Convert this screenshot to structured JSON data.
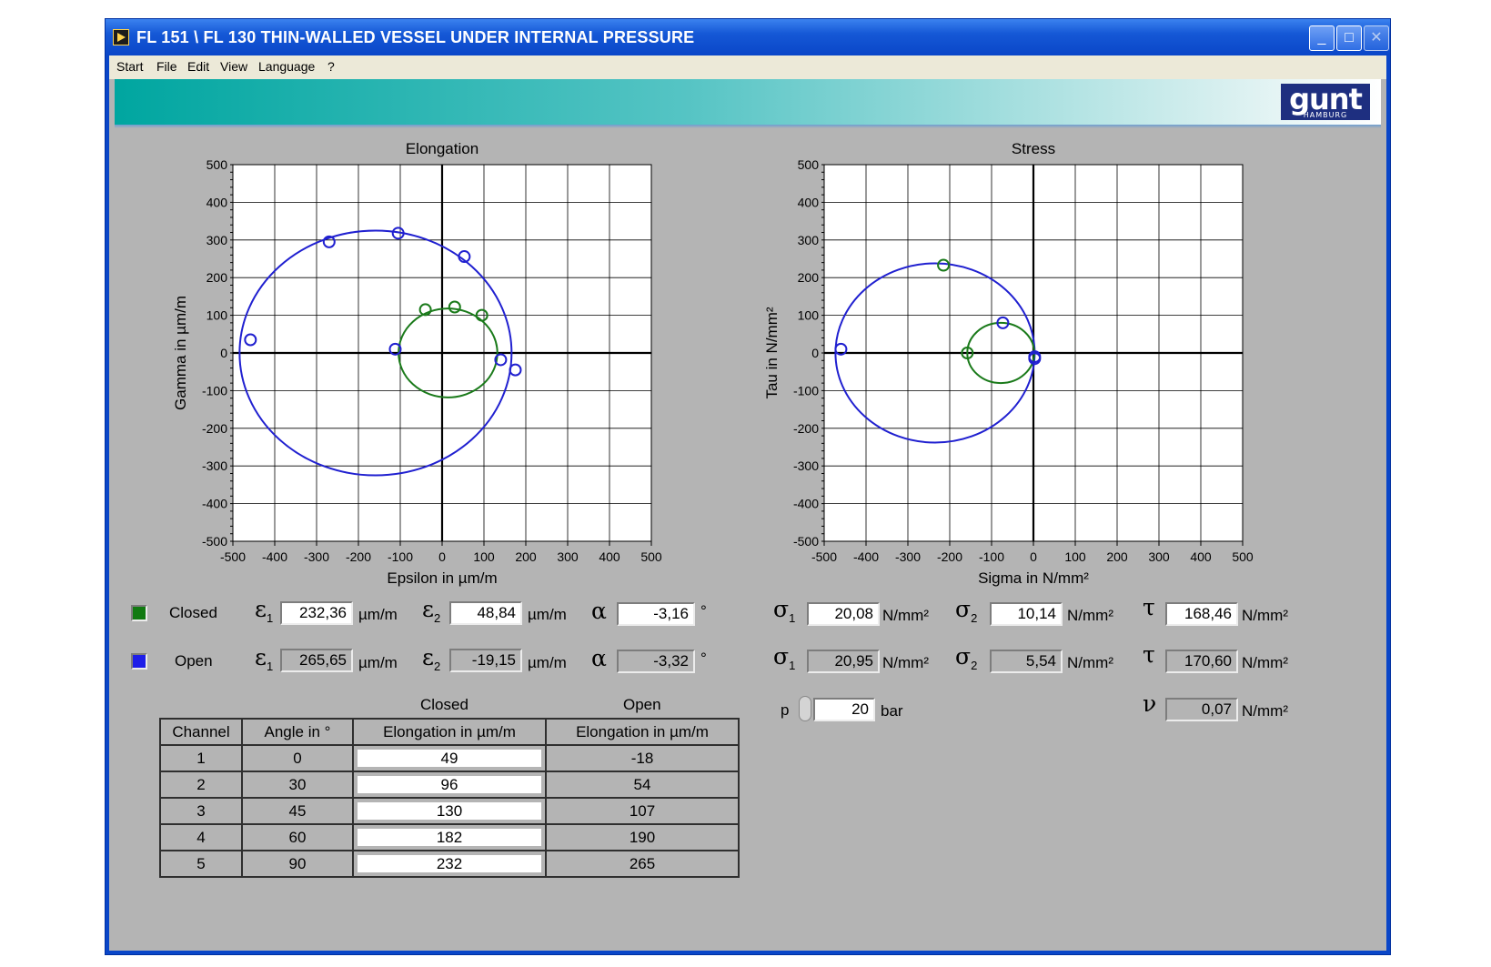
{
  "window": {
    "title": "FL 151 \\ FL 130 THIN-WALLED VESSEL UNDER INTERNAL PRESSURE",
    "min_symbol": "_",
    "max_symbol": "□",
    "close_symbol": "✕"
  },
  "menu": {
    "items": [
      "Start",
      "File",
      "Edit",
      "View",
      "Language",
      "?"
    ]
  },
  "logo": {
    "text": "gunt",
    "subtext": "HAMBURG"
  },
  "chart_data": [
    {
      "type": "scatter",
      "title": "Elongation",
      "xlabel": "Epsilon in µm/m",
      "ylabel": "Gamma in µm/m",
      "xlim": [
        -500,
        500
      ],
      "ylim": [
        -500,
        500
      ],
      "xticks": [
        "-500",
        "-400",
        "-300",
        "-200",
        "-100",
        "0",
        "100",
        "200",
        "300",
        "400",
        "500"
      ],
      "yticks": [
        "500",
        "400",
        "300",
        "200",
        "100",
        "0",
        "-100",
        "-200",
        "-300",
        "-400",
        "-500"
      ],
      "grid": true,
      "circles": [
        {
          "center": [
            -159,
            0
          ],
          "radius": 325,
          "color": "#2020d0"
        },
        {
          "center": [
            14,
            0
          ],
          "radius": 118,
          "color": "#1a7a1a"
        }
      ],
      "series": [
        {
          "color": "#2020d0",
          "points": [
            [
              -458,
              35
            ],
            [
              -270,
              295
            ],
            [
              -105,
              318
            ],
            [
              53,
              256
            ],
            [
              140,
              -18
            ],
            [
              175,
              -45
            ],
            [
              -112,
              10
            ]
          ]
        },
        {
          "color": "#1a7a1a",
          "points": [
            [
              -40,
              115
            ],
            [
              30,
              122
            ],
            [
              95,
              100
            ]
          ]
        }
      ]
    },
    {
      "type": "scatter",
      "title": "Stress",
      "xlabel": "Sigma in N/mm²",
      "ylabel": "Tau in N/mm²",
      "xlim": [
        -500,
        500
      ],
      "ylim": [
        -500,
        500
      ],
      "xticks": [
        "-500",
        "-400",
        "-300",
        "-200",
        "-100",
        "0",
        "100",
        "200",
        "300",
        "400",
        "500"
      ],
      "yticks": [
        "500",
        "400",
        "300",
        "200",
        "100",
        "0",
        "-100",
        "-200",
        "-300",
        "-400",
        "-500"
      ],
      "grid": true,
      "circles": [
        {
          "center": [
            -235,
            0
          ],
          "radius": 238,
          "color": "#2020d0"
        },
        {
          "center": [
            -78,
            0
          ],
          "radius": 80,
          "color": "#1a7a1a"
        }
      ],
      "series": [
        {
          "color": "#1a7a1a",
          "points": [
            [
              -215,
              233
            ],
            [
              -158,
              0
            ]
          ]
        },
        {
          "color": "#2020d0",
          "points": [
            [
              -460,
              10
            ],
            [
              -73,
              80
            ],
            [
              3,
              -10
            ],
            [
              3,
              -15
            ]
          ]
        }
      ]
    }
  ],
  "legend": {
    "closed": {
      "label": "Closed",
      "color": "#117a11"
    },
    "open": {
      "label": "Open",
      "color": "#1e1ee8"
    }
  },
  "elongation": {
    "eps1_symbol": "ε",
    "eps2_symbol": "ε",
    "alpha_symbol": "α",
    "sub1": "1",
    "sub2": "2",
    "unit": "µm/m",
    "degree": "°",
    "closed": {
      "eps1": "232,36",
      "eps2": "48,84",
      "alpha": "-3,16"
    },
    "open": {
      "eps1": "265,65",
      "eps2": "-19,15",
      "alpha": "-3,32"
    }
  },
  "stress": {
    "sigma_symbol": "σ",
    "tau_symbol": "τ",
    "nu_symbol": "ν",
    "unit": "N/mm²",
    "closed": {
      "sigma1": "20,08",
      "sigma2": "10,14",
      "tau": "168,46"
    },
    "open": {
      "sigma1": "20,95",
      "sigma2": "5,54",
      "tau": "170,60"
    },
    "nu": "0,07"
  },
  "pressure": {
    "label": "p",
    "value": "20",
    "unit": "bar"
  },
  "table": {
    "group_closed": "Closed",
    "group_open": "Open",
    "headers": [
      "Channel",
      "Angle in °",
      "Elongation in µm/m",
      "Elongation in µm/m"
    ],
    "rows": [
      [
        "1",
        "0",
        "49",
        "-18"
      ],
      [
        "2",
        "30",
        "96",
        "54"
      ],
      [
        "3",
        "45",
        "130",
        "107"
      ],
      [
        "4",
        "60",
        "182",
        "190"
      ],
      [
        "5",
        "90",
        "232",
        "265"
      ]
    ]
  }
}
